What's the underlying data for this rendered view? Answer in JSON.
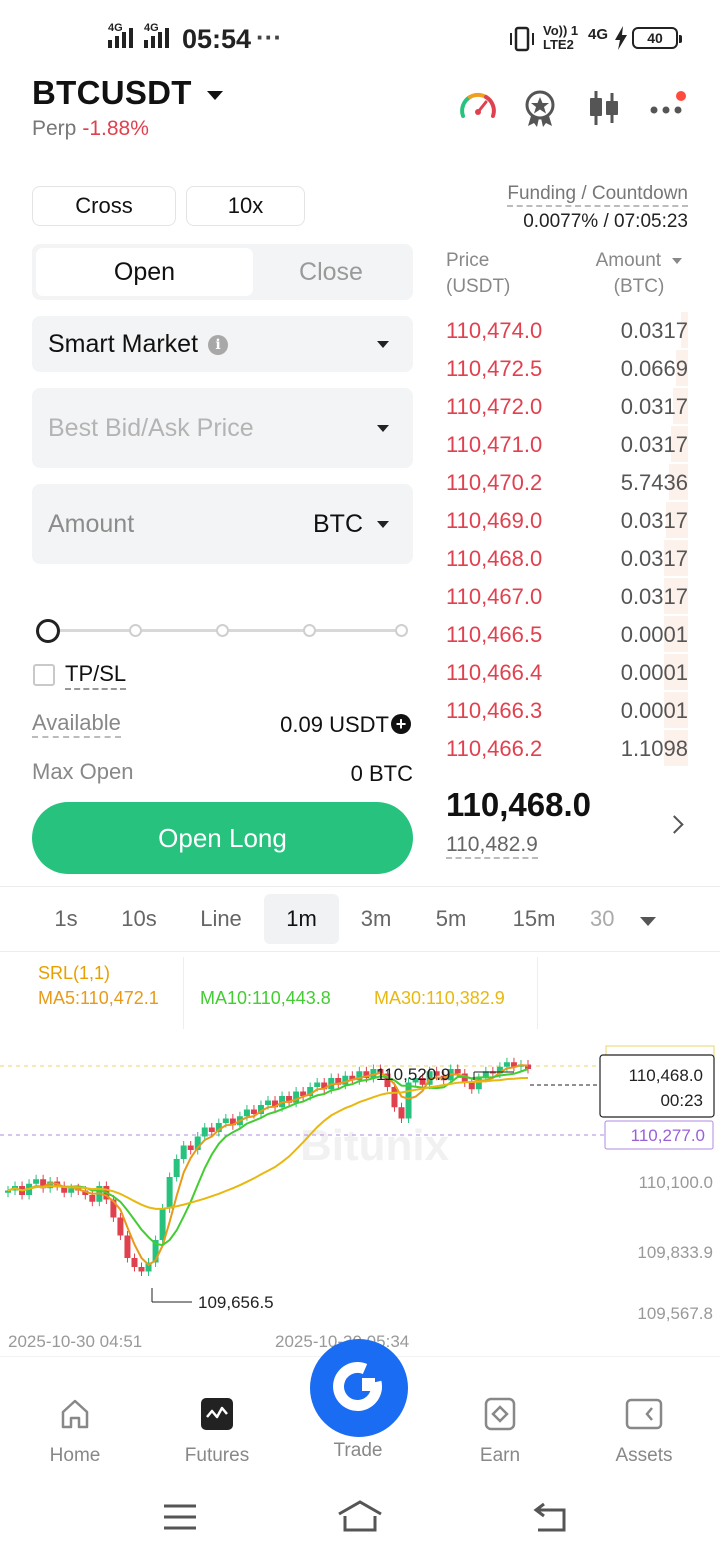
{
  "status_bar": {
    "time": "05:54",
    "more": "···",
    "sim1": "4G",
    "sim2": "4G",
    "volte": "Vo)) 1",
    "lte": "LTE2",
    "net": "4G",
    "battery": "40"
  },
  "header": {
    "symbol": "BTCUSDT",
    "type": "Perp",
    "change": "-1.88%"
  },
  "icons": [
    "gauge-icon",
    "award-icon",
    "candlestick-icon",
    "more-dots-icon"
  ],
  "margin": {
    "mode": "Cross",
    "leverage": "10x"
  },
  "funding": {
    "label": "Funding / Countdown",
    "value": "0.0077% / 07:05:23"
  },
  "tabs": {
    "open": "Open",
    "close": "Close"
  },
  "order_type": "Smart Market",
  "price_placeholder": "Best Bid/Ask Price",
  "amount": {
    "label": "Amount",
    "unit": "BTC"
  },
  "tpsl": "TP/SL",
  "available": {
    "label": "Available",
    "value": "0.09 USDT"
  },
  "max_open": {
    "label": "Max Open",
    "value": "0 BTC"
  },
  "open_long": "Open Long",
  "orderbook": {
    "price_header": "Price",
    "price_unit": "(USDT)",
    "amount_header": "Amount",
    "amount_unit": "(BTC)",
    "asks": [
      {
        "price": "110,474.0",
        "amount": "0.0317",
        "depth": 0.03
      },
      {
        "price": "110,472.5",
        "amount": "0.0669",
        "depth": 0.05
      },
      {
        "price": "110,472.0",
        "amount": "0.0317",
        "depth": 0.06
      },
      {
        "price": "110,471.0",
        "amount": "0.0317",
        "depth": 0.07
      },
      {
        "price": "110,470.2",
        "amount": "5.7436",
        "depth": 0.08
      },
      {
        "price": "110,469.0",
        "amount": "0.0317",
        "depth": 0.09
      },
      {
        "price": "110,468.0",
        "amount": "0.0317",
        "depth": 0.1
      },
      {
        "price": "110,467.0",
        "amount": "0.0317",
        "depth": 0.1
      },
      {
        "price": "110,466.5",
        "amount": "0.0001",
        "depth": 0.1
      },
      {
        "price": "110,466.4",
        "amount": "0.0001",
        "depth": 0.1
      },
      {
        "price": "110,466.3",
        "amount": "0.0001",
        "depth": 0.1
      },
      {
        "price": "110,466.2",
        "amount": "1.1098",
        "depth": 0.1
      }
    ],
    "last_price": "110,468.0",
    "mark_price": "110,482.9"
  },
  "timeframes": [
    "1s",
    "10s",
    "Line",
    "1m",
    "3m",
    "5m",
    "15m",
    "30"
  ],
  "active_timeframe": "1m",
  "indicators": {
    "srl": "SRL(1,1)",
    "ma5": "MA5:110,472.1",
    "ma10": "MA10:110,443.8",
    "ma30": "MA30:110,382.9"
  },
  "chart": {
    "high_label": "110,520.9",
    "low_label": "109,656.5",
    "current_price": "110,468.0",
    "countdown": "00:23",
    "line_price": "110,277.0",
    "y_ticks": [
      "110,100.0",
      "109,833.9",
      "109,567.8"
    ],
    "x_ticks": [
      "2025-10-30 04:51",
      "2025-10-30 05:34"
    ],
    "watermark": "Bitunix"
  },
  "chart_data": {
    "type": "candlestick",
    "ma_colors": {
      "MA5": "#e89a18",
      "MA10": "#44cc33",
      "MA30": "#e8b810"
    },
    "up_color": "#27c27e",
    "down_color": "#e0414f"
  },
  "nav": {
    "home": "Home",
    "futures": "Futures",
    "trade": "Trade",
    "earn": "Earn",
    "assets": "Assets"
  },
  "colors": {
    "accent_green": "#27c27e",
    "accent_red": "#e0414f",
    "brand_blue": "#1a6cf2"
  }
}
